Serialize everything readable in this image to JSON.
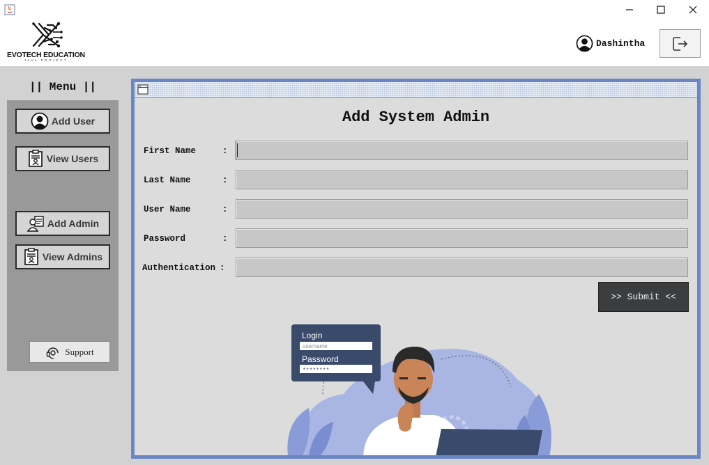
{
  "window": {
    "controls": [
      "minimize-icon",
      "maximize-icon",
      "close-icon"
    ]
  },
  "brand": {
    "name": "EVOTECH EDUCATION",
    "tagline": "JAVA PROJECT"
  },
  "user": {
    "name": "Dashintha"
  },
  "sidebar": {
    "title": "|| Menu ||",
    "items": [
      {
        "label": "Add User",
        "icon": "user-icon"
      },
      {
        "label": "View Users",
        "icon": "id-card-icon"
      },
      {
        "label": "Add Admin",
        "icon": "admin-icon"
      },
      {
        "label": "View Admins",
        "icon": "id-card-icon"
      }
    ],
    "support_label": "Support"
  },
  "form": {
    "title": "Add System Admin",
    "fields": [
      {
        "label": "First Name",
        "colon": ":",
        "value": ""
      },
      {
        "label": "Last Name",
        "colon": ":",
        "value": ""
      },
      {
        "label": "User Name",
        "colon": ":",
        "value": ""
      },
      {
        "label": "Password",
        "colon": ":",
        "value": ""
      },
      {
        "label": "Authentication",
        "colon": ":",
        "value": ""
      }
    ],
    "submit_label": ">> Submit <<"
  },
  "illustration": {
    "login_title": "Login",
    "username_placeholder": "username",
    "password_title": "Password",
    "password_mask": "********"
  },
  "colors": {
    "frame_border": "#6a86c4",
    "sidebar_bg": "#999999",
    "submit_bg": "#3b3d3f",
    "illustration_blue": "#a9b6e3"
  }
}
